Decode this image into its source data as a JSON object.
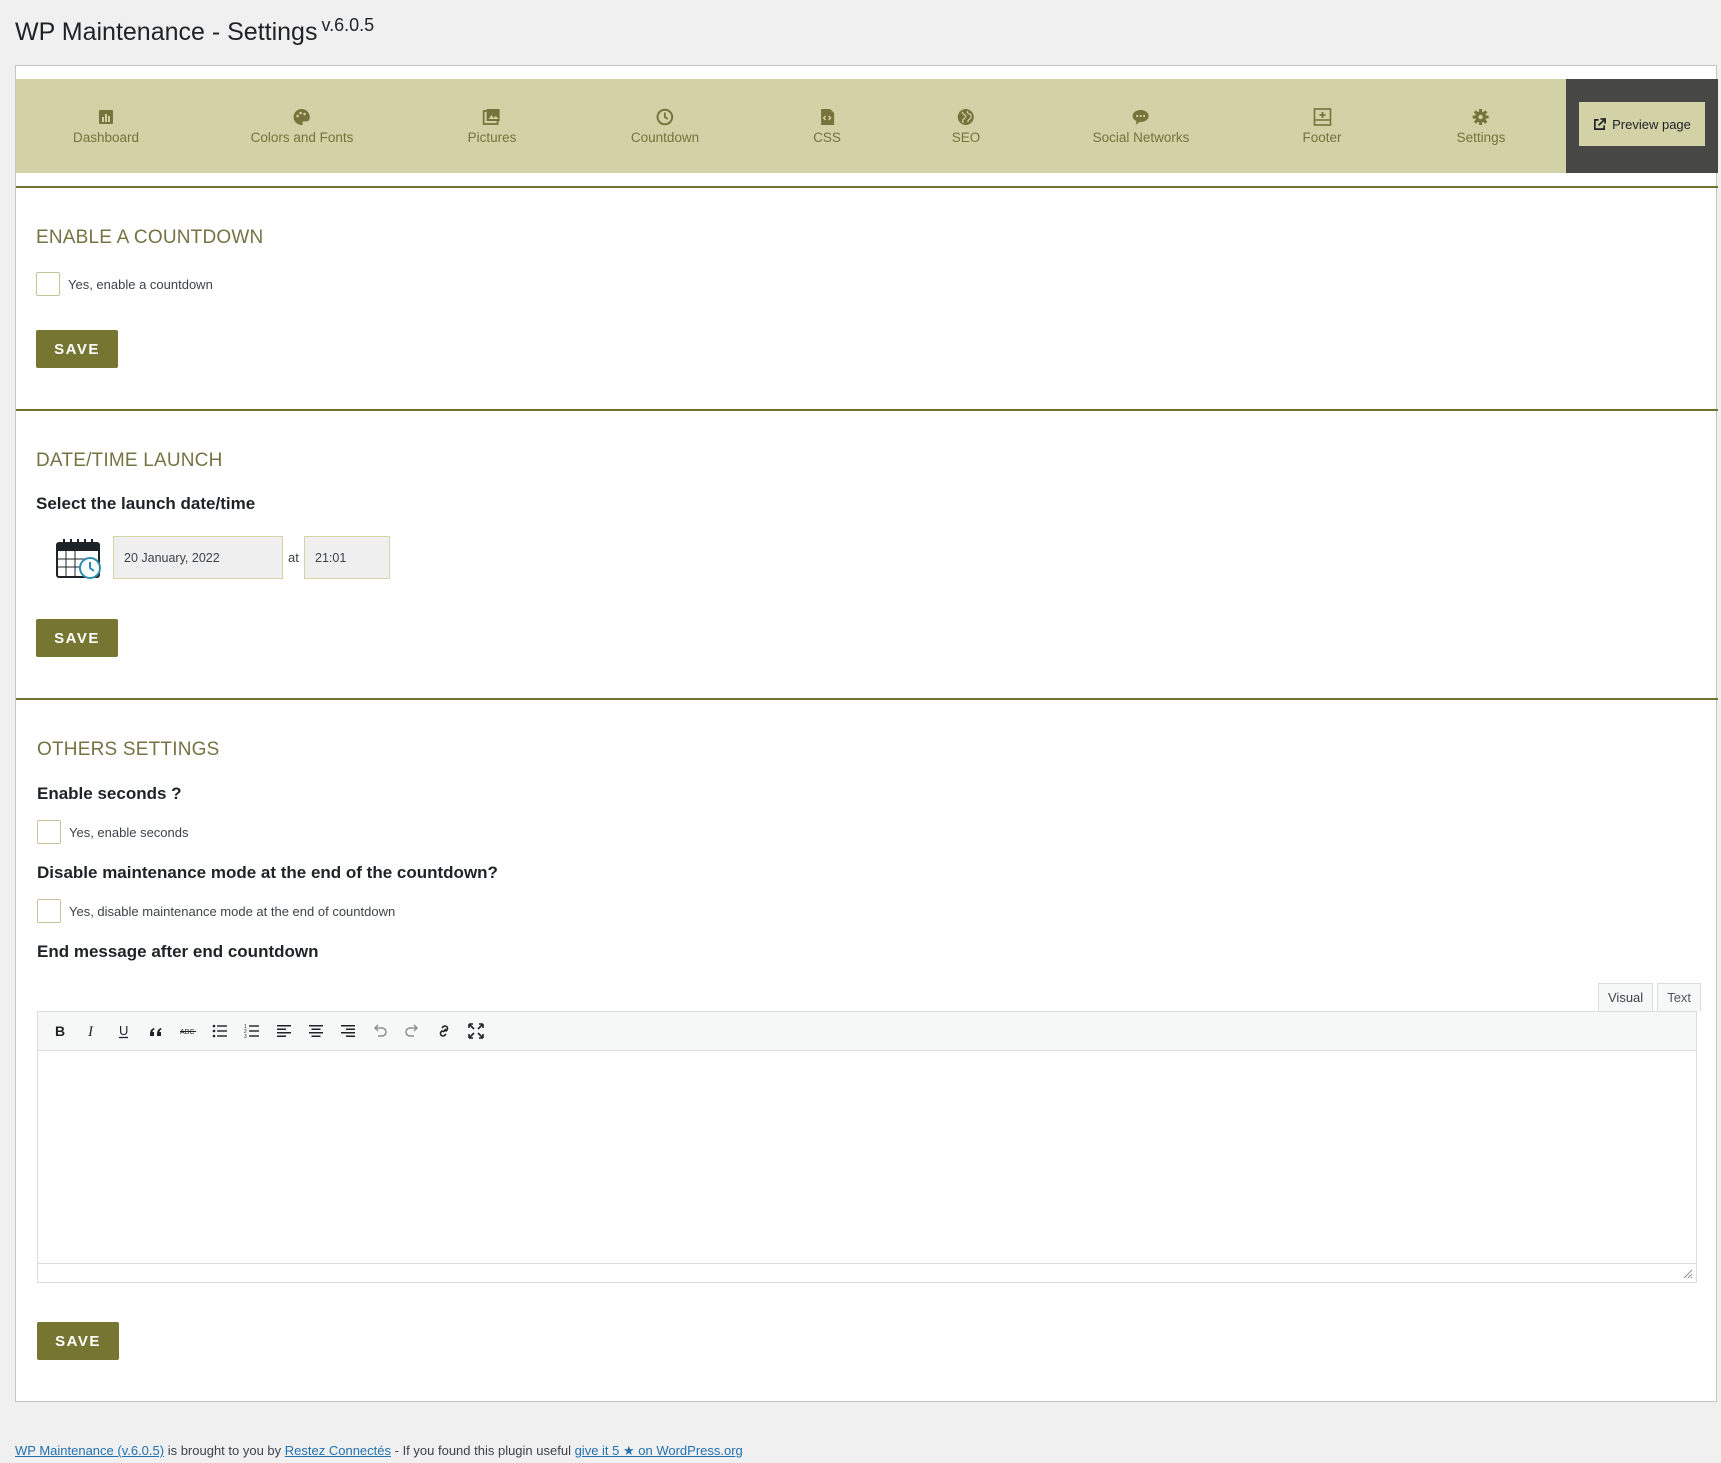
{
  "page": {
    "title": "WP Maintenance - Settings",
    "version": "v.6.0.5"
  },
  "nav": {
    "items": [
      {
        "label": "Dashboard",
        "icon": "dashboard-icon"
      },
      {
        "label": "Colors and Fonts",
        "icon": "palette-icon"
      },
      {
        "label": "Pictures",
        "icon": "pictures-icon"
      },
      {
        "label": "Countdown",
        "icon": "clock-icon"
      },
      {
        "label": "CSS",
        "icon": "code-file-icon"
      },
      {
        "label": "SEO",
        "icon": "globe-icon"
      },
      {
        "label": "Social Networks",
        "icon": "chat-bubble-icon"
      },
      {
        "label": "Footer",
        "icon": "footer-layout-icon"
      },
      {
        "label": "Settings",
        "icon": "gear-icon"
      }
    ],
    "preview_label": "Preview page"
  },
  "countdown_section": {
    "title": "ENABLE A COUNTDOWN",
    "checkbox_label": "Yes, enable a countdown",
    "save_label": "SAVE"
  },
  "datetime_section": {
    "title": "DATE/TIME LAUNCH",
    "field_label": "Select the launch date/time",
    "date_value": "20 January, 2022",
    "at_label": "at",
    "time_value": "21:01",
    "save_label": "SAVE"
  },
  "others_section": {
    "title": "OTHERS SETTINGS",
    "seconds_label": "Enable seconds ?",
    "seconds_checkbox": "Yes, enable seconds",
    "disable_label": "Disable maintenance mode at the end of the countdown?",
    "disable_checkbox": "Yes, disable maintenance mode at the end of countdown",
    "end_message_label": "End message after end countdown",
    "editor_tabs": [
      "Visual",
      "Text"
    ],
    "toolbar_icons": [
      "bold-icon",
      "italic-icon",
      "underline-icon",
      "blockquote-icon",
      "strikethrough-icon",
      "bullet-list-icon",
      "numbered-list-icon",
      "align-left-icon",
      "align-center-icon",
      "align-right-icon",
      "undo-icon",
      "redo-icon",
      "link-icon",
      "fullscreen-icon"
    ],
    "save_label": "SAVE"
  },
  "footer": {
    "link1": "WP Maintenance (v.6.0.5)",
    "text1": " is brought to you by ",
    "link2": "Restez Connectés",
    "text2": " - If you found this plugin useful ",
    "link3": "give it 5 ★ on WordPress.org"
  },
  "colors": {
    "accent": "#767532",
    "nav_bg": "#d3d1a6",
    "nav_text": "#76733b",
    "preview_bg": "#474746",
    "section_title": "#757343"
  }
}
